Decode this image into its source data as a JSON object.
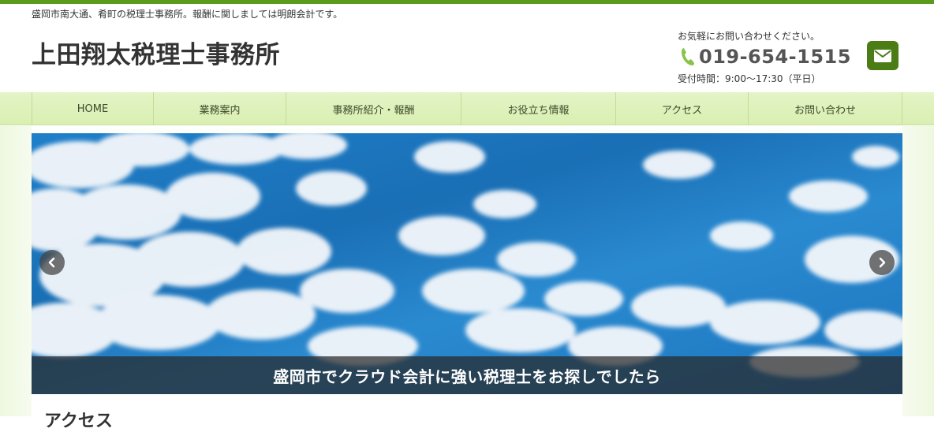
{
  "header": {
    "tagline": "盛岡市南大通、肴町の税理士事務所。報酬に関しましては明朗会計です。",
    "site_title": "上田翔太税理士事務所",
    "contact_lead": "お気軽にお問い合わせください。",
    "phone_number": "019-654-1515",
    "hours": "受付時間：9:00〜17:30（平日）",
    "mail_icon": "envelope-icon",
    "phone_icon": "phone-icon"
  },
  "nav": {
    "items": [
      {
        "label": "HOME"
      },
      {
        "label": "業務案内"
      },
      {
        "label": "事務所紹介・報酬"
      },
      {
        "label": "お役立ち情報"
      },
      {
        "label": "アクセス"
      },
      {
        "label": "お問い合わせ"
      }
    ]
  },
  "hero": {
    "caption": "盛岡市でクラウド会計に強い税理士をお探しでしたら",
    "prev_icon": "chevron-left-icon",
    "next_icon": "chevron-right-icon"
  },
  "content": {
    "heading": "アクセス"
  },
  "colors": {
    "accent_green": "#5a9a1c",
    "mail_button": "#4b7c16",
    "nav_bg": "#e4f4c6",
    "phone_icon": "#8bc34a"
  }
}
